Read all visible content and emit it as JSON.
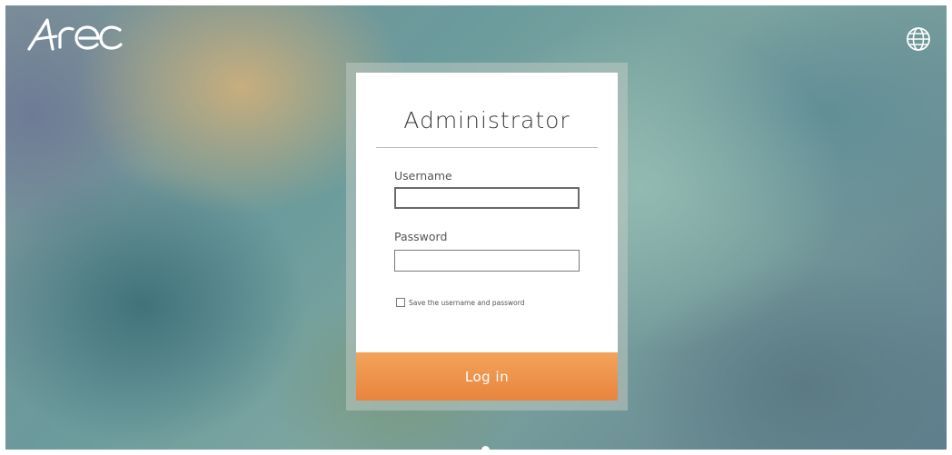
{
  "brand": {
    "logo_text": "Arec"
  },
  "header": {
    "language_icon": "globe-icon"
  },
  "login": {
    "title": "Administrator",
    "username_label": "Username",
    "username_value": "",
    "password_label": "Password",
    "password_value": "",
    "remember_label": "Save the username and password",
    "remember_checked": false,
    "submit_label": "Log in"
  },
  "pager": {
    "current": 1,
    "total": 1
  },
  "colors": {
    "accent": "#ec8d47",
    "card_bg": "#ffffff",
    "text": "#3a3a3a"
  }
}
